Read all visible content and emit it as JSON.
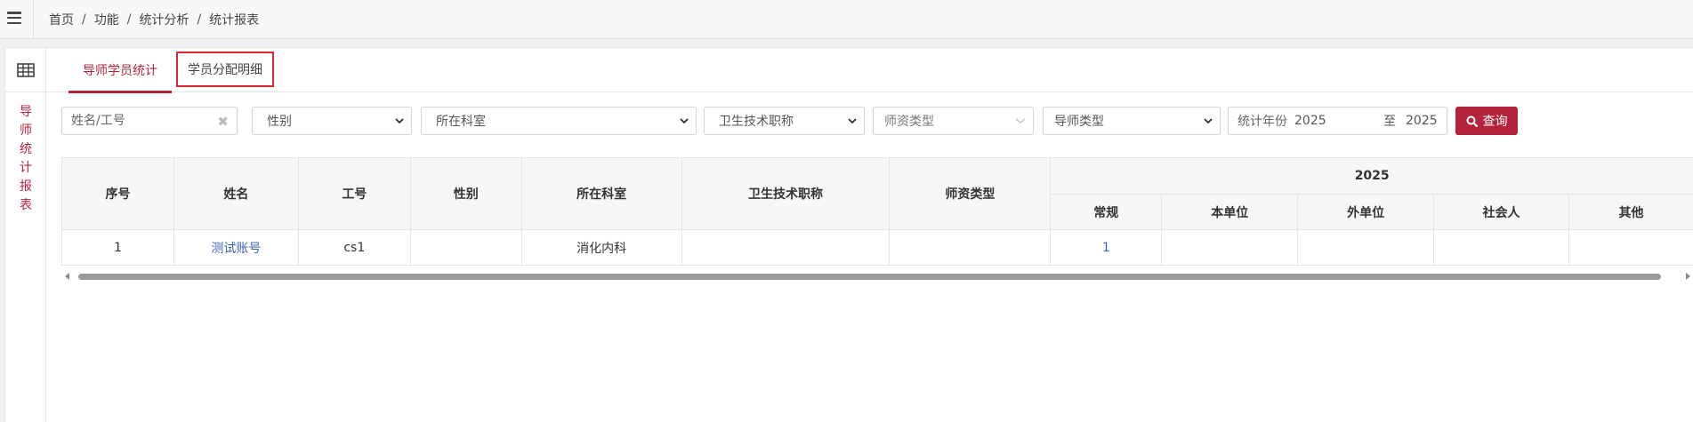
{
  "breadcrumb": [
    "首页",
    "功能",
    "统计分析",
    "统计报表"
  ],
  "side_title": [
    "导",
    "师",
    "统",
    "计",
    "报",
    "表"
  ],
  "tabs": [
    {
      "label": "导师学员统计",
      "active": true
    },
    {
      "label": "学员分配明细",
      "active": false
    }
  ],
  "filters": {
    "name_placeholder": "姓名/工号",
    "gender": "性别",
    "department": "所在科室",
    "tech_title": "卫生技术职称",
    "faculty_type": "师资类型",
    "mentor_type": "导师类型",
    "year_label": "统计年份",
    "year_from": "2025",
    "year_sep": "至",
    "year_to": "2025",
    "search_label": "查询"
  },
  "table": {
    "columns": [
      "序号",
      "姓名",
      "工号",
      "性别",
      "所在科室",
      "卫生技术职称",
      "师资类型"
    ],
    "group_header": "2025",
    "sub_columns": [
      "常规",
      "本单位",
      "外单位",
      "社会人",
      "其他"
    ],
    "rows": [
      {
        "no": "1",
        "name": "测试账号",
        "id": "cs1",
        "gender": "",
        "dept": "消化内科",
        "title": "",
        "faculty": "",
        "regular": "1",
        "internal": "",
        "external": "",
        "social": "",
        "other": ""
      }
    ]
  },
  "colors": {
    "accent": "#b3243a",
    "link": "#3d63b5",
    "highlight_box": "#d9262f"
  }
}
